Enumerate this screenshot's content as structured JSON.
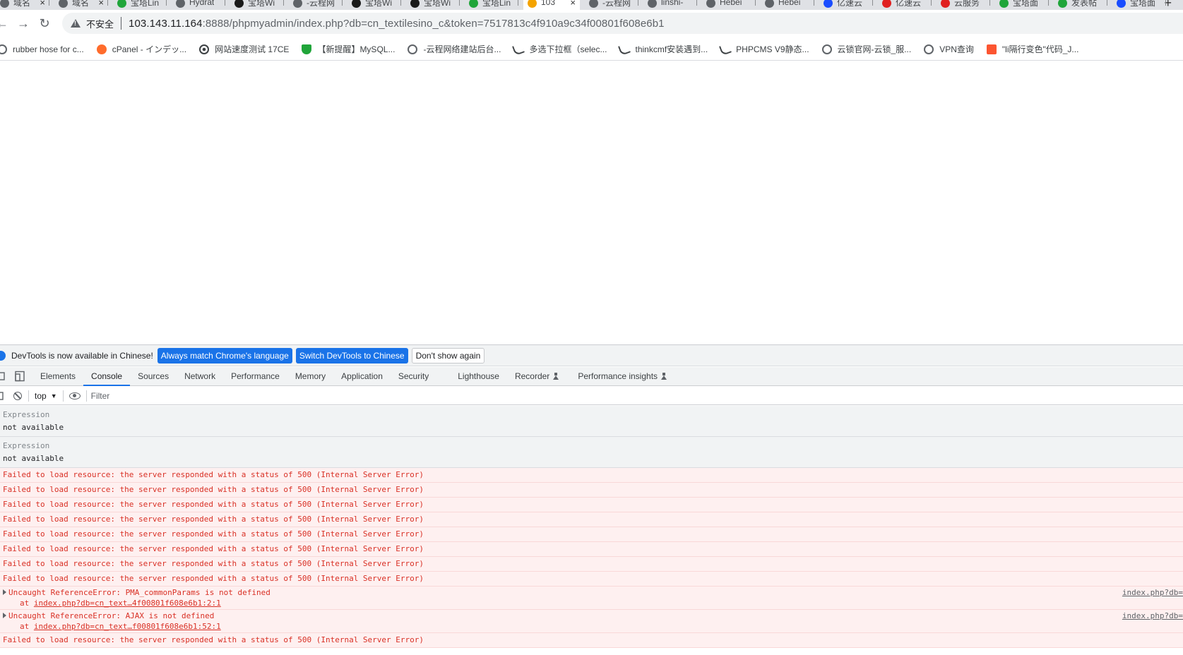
{
  "tabs": [
    {
      "title": "域名",
      "active": false,
      "close": true
    },
    {
      "title": "域名",
      "active": false,
      "close": true
    },
    {
      "title": "宝塔Lin",
      "active": false,
      "close": false
    },
    {
      "title": "Hydrat",
      "active": false,
      "close": false
    },
    {
      "title": "宝塔Wi",
      "active": false,
      "close": false
    },
    {
      "title": "-云程网",
      "active": false,
      "close": false
    },
    {
      "title": "宝塔Wi",
      "active": false,
      "close": false
    },
    {
      "title": "宝塔Wi",
      "active": false,
      "close": false
    },
    {
      "title": "宝塔Lin",
      "active": false,
      "close": false
    },
    {
      "title": "103",
      "active": true,
      "close": true
    },
    {
      "title": "-云程网",
      "active": false,
      "close": false
    },
    {
      "title": "linshi-",
      "active": false,
      "close": false
    },
    {
      "title": "Hebei",
      "active": false,
      "close": false
    },
    {
      "title": "Hebei",
      "active": false,
      "close": false
    },
    {
      "title": "亿速云",
      "active": false,
      "close": false
    },
    {
      "title": "亿速云",
      "active": false,
      "close": false
    },
    {
      "title": "云服务",
      "active": false,
      "close": false
    },
    {
      "title": "宝塔面",
      "active": false,
      "close": false
    },
    {
      "title": "发表帖",
      "active": false,
      "close": false
    },
    {
      "title": "宝塔面",
      "active": false,
      "close": false
    }
  ],
  "new_tab_symbol": "+",
  "toolbar": {
    "back": "←",
    "forward": "→",
    "reload": "↻",
    "insecure_label": "不安全",
    "url_host": "103.143.11.164",
    "url_rest": ":8888/phpmyadmin/index.php?db=cn_textilesino_c&token=7517813c4f910a9c34f00801f608e6b1"
  },
  "bookmarks": [
    {
      "label": "rubber hose for c...",
      "icon": "globe-icon",
      "color": "#5f6368"
    },
    {
      "label": "cPanel - インデッ...",
      "icon": "cpanel-icon",
      "color": "#ff6c2c"
    },
    {
      "label": "网站速度测试 17CE",
      "icon": "eye-icon",
      "color": "#3c4043"
    },
    {
      "label": "【新提醒】MySQL...",
      "icon": "shield-icon",
      "color": "#20a53a"
    },
    {
      "label": "-云程网络建站后台...",
      "icon": "globe-icon",
      "color": "#5f6368"
    },
    {
      "label": "多选下拉框（selec...",
      "icon": "bird-icon",
      "color": "#3c4043"
    },
    {
      "label": "thinkcmf安装遇到...",
      "icon": "bird-icon",
      "color": "#3c4043"
    },
    {
      "label": "PHPCMS V9静态...",
      "icon": "bird-icon",
      "color": "#3c4043"
    },
    {
      "label": "云锁官网-云锁_服...",
      "icon": "globe-icon",
      "color": "#5f6368"
    },
    {
      "label": "VPN查询",
      "icon": "globe-icon",
      "color": "#5f6368"
    },
    {
      "label": "\"li隔行变色\"代码_J...",
      "icon": "csdn-icon",
      "color": "#fc5531"
    }
  ],
  "devtools": {
    "infobar": {
      "message": "DevTools is now available in Chinese!",
      "btn_match": "Always match Chrome's language",
      "btn_switch": "Switch DevTools to Chinese",
      "btn_dismiss": "Don't show again"
    },
    "tabs": [
      "Elements",
      "Console",
      "Sources",
      "Network",
      "Performance",
      "Memory",
      "Application",
      "Security",
      "Lighthouse",
      "Recorder",
      "Performance insights"
    ],
    "active_tab": "Console",
    "experimental_tabs": [
      "Recorder",
      "Performance insights"
    ],
    "context": "top",
    "filter_placeholder": "Filter",
    "expressions": [
      {
        "label": "Expression",
        "value": "not available"
      },
      {
        "label": "Expression",
        "value": "not available"
      }
    ],
    "messages": [
      {
        "kind": "error",
        "text": "Failed to load resource: the server responded with a status of 500 (Internal Server Error)"
      },
      {
        "kind": "error",
        "text": "Failed to load resource: the server responded with a status of 500 (Internal Server Error)"
      },
      {
        "kind": "error",
        "text": "Failed to load resource: the server responded with a status of 500 (Internal Server Error)"
      },
      {
        "kind": "error",
        "text": "Failed to load resource: the server responded with a status of 500 (Internal Server Error)"
      },
      {
        "kind": "error",
        "text": "Failed to load resource: the server responded with a status of 500 (Internal Server Error)"
      },
      {
        "kind": "error",
        "text": "Failed to load resource: the server responded with a status of 500 (Internal Server Error)"
      },
      {
        "kind": "error",
        "text": "Failed to load resource: the server responded with a status of 500 (Internal Server Error)"
      },
      {
        "kind": "error",
        "text": "Failed to load resource: the server responded with a status of 500 (Internal Server Error)"
      },
      {
        "kind": "exception",
        "text": "Uncaught ReferenceError: PMA_commonParams is not defined",
        "at_prefix": "at ",
        "at_link": "index.php?db=cn_text…4f00801f608e6b1:2:1",
        "source": "index.php?db="
      },
      {
        "kind": "exception",
        "text": "Uncaught ReferenceError: AJAX is not defined",
        "at_prefix": "at ",
        "at_link": "index.php?db=cn_text…f00801f608e6b1:52:1",
        "source": "index.php?db="
      },
      {
        "kind": "error",
        "text": "Failed to load resource: the server responded with a status of 500 (Internal Server Error)"
      }
    ]
  },
  "colors": {
    "accent": "#1a73e8",
    "error_text": "#d93025",
    "error_bg": "#fef0f0"
  }
}
